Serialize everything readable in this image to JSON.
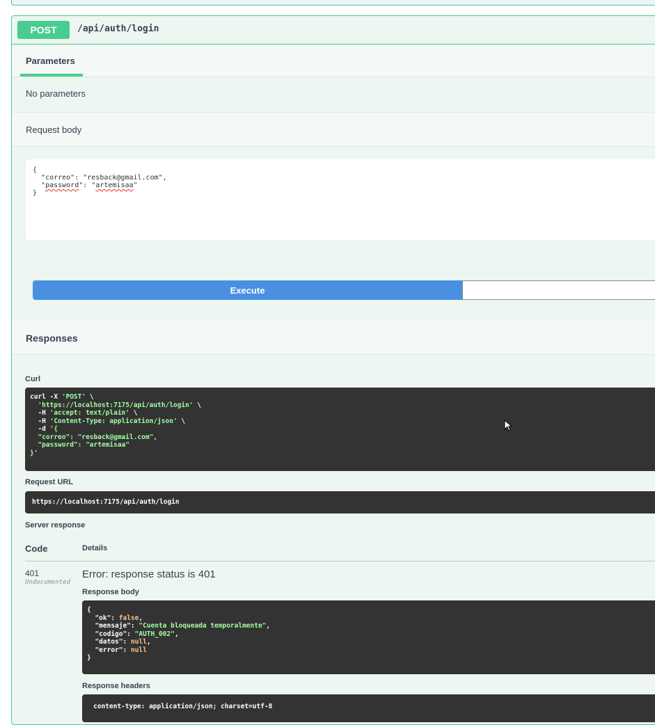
{
  "operation": {
    "method": "POST",
    "path": "/api/auth/login"
  },
  "parameters": {
    "tab_label": "Parameters",
    "empty_text": "No parameters"
  },
  "request_body": {
    "label": "Request body",
    "line1": "{",
    "line2_key": "  \"correo\": \"resback@gmail.com\",",
    "line3_a": "  \"",
    "line3_key": "password",
    "line3_b": "\": \"",
    "line3_val": "artemisaa",
    "line3_c": "\"",
    "line4": "}"
  },
  "execute_label": "Execute",
  "responses": {
    "title": "Responses",
    "curl_label": "Curl",
    "curl_lines": {
      "l1a": "curl -X ",
      "l1b": "'POST'",
      "l1c": " \\",
      "l2a": "  ",
      "l2b": "'https://localhost:7175/api/auth/login'",
      "l2c": " \\",
      "l3a": "  -H ",
      "l3b": "'accept: text/plain'",
      "l3c": " \\",
      "l4a": "  -H ",
      "l4b": "'Content-Type: application/json'",
      "l4c": " \\",
      "l5a": "  -d ",
      "l5b": "'{",
      "l6": "  \"correo\": \"resback@gmail.com\",",
      "l7": "  \"password\": \"artemisaa\"",
      "l8": "}'"
    },
    "request_url_label": "Request URL",
    "request_url": "https://localhost:7175/api/auth/login",
    "server_response_label": "Server response",
    "code_header": "Code",
    "details_header": "Details",
    "status_code": "401",
    "undocumented": "Undocumented",
    "error_message": "Error: response status is 401",
    "response_body_label": "Response body",
    "response_body": {
      "open": "{",
      "ok_key": "  \"ok\": ",
      "ok_val": "false",
      "ok_end": ",",
      "msg_key": "  \"mensaje\": ",
      "msg_val": "\"Cuenta bloqueada temporalmente\"",
      "msg_end": ",",
      "code_key": "  \"codigo\": ",
      "code_val": "\"AUTH_002\"",
      "code_end": ",",
      "datos_key": "  \"datos\": ",
      "datos_val": "null",
      "datos_end": ",",
      "error_key": "  \"error\": ",
      "error_val": "null",
      "close": "}"
    },
    "response_headers_label": "Response headers",
    "response_headers": "content-type: application/json; charset=utf-8"
  }
}
